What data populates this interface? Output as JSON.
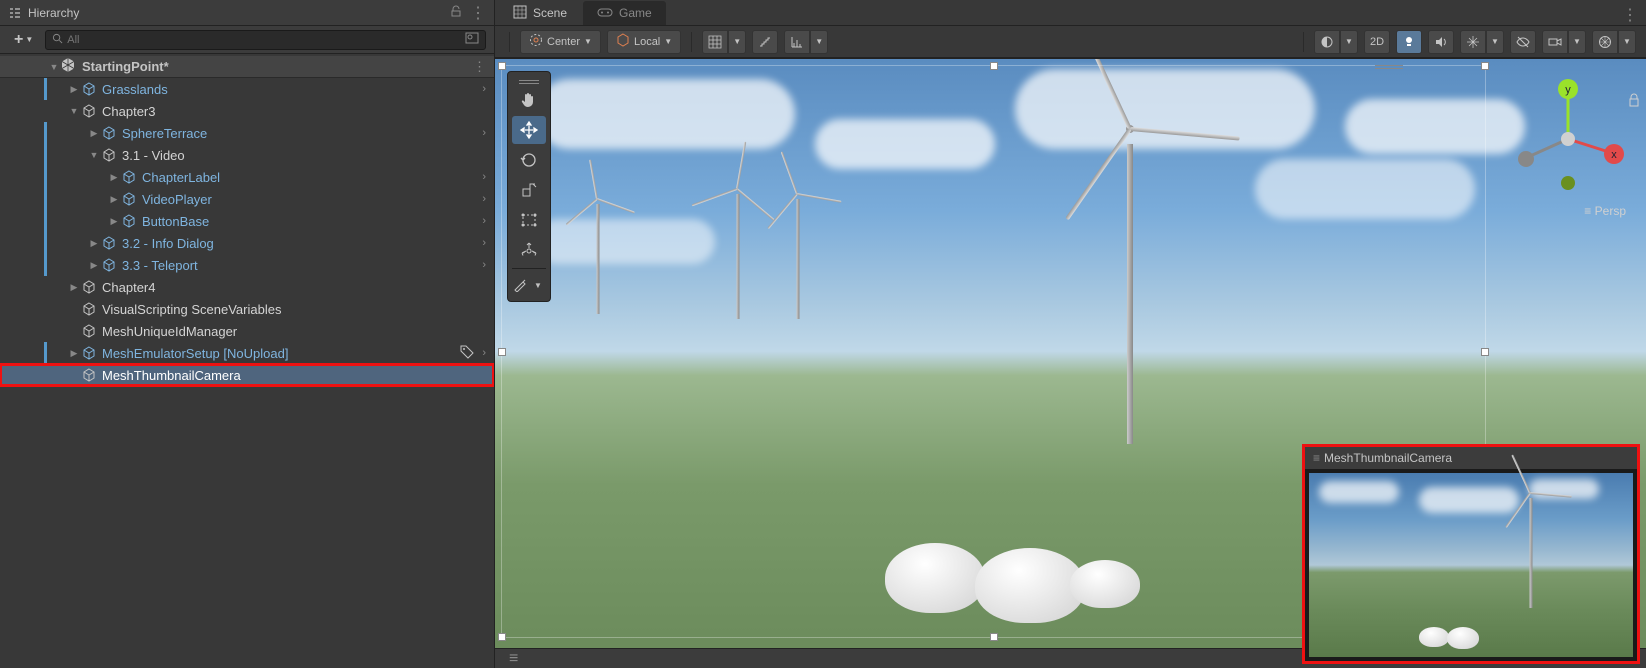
{
  "hierarchy": {
    "panel_title": "Hierarchy",
    "search_placeholder": "All",
    "add_label": "+",
    "scene_root": "StartingPoint*",
    "nodes": [
      {
        "id": "grasslands",
        "label": "Grasslands",
        "depth": 1,
        "color": "blue",
        "expand": "closed",
        "prefab": true
      },
      {
        "id": "chapter3",
        "label": "Chapter3",
        "depth": 1,
        "color": "white",
        "expand": "open",
        "prefab": false
      },
      {
        "id": "sphereterrace",
        "label": "SphereTerrace",
        "depth": 2,
        "color": "blue",
        "expand": "closed",
        "prefab": true
      },
      {
        "id": "video31",
        "label": "3.1 - Video",
        "depth": 2,
        "color": "white",
        "expand": "open",
        "prefab": false
      },
      {
        "id": "chapterlabel",
        "label": "ChapterLabel",
        "depth": 3,
        "color": "blue",
        "expand": "closed",
        "prefab": true
      },
      {
        "id": "videoplayer",
        "label": "VideoPlayer",
        "depth": 3,
        "color": "blue",
        "expand": "closed",
        "prefab": true
      },
      {
        "id": "buttonbase",
        "label": "ButtonBase",
        "depth": 3,
        "color": "blue",
        "expand": "closed",
        "prefab": true
      },
      {
        "id": "infodialog",
        "label": "3.2 - Info Dialog",
        "depth": 2,
        "color": "blue",
        "expand": "closed",
        "prefab": true
      },
      {
        "id": "teleport",
        "label": "3.3 - Teleport",
        "depth": 2,
        "color": "blue",
        "expand": "closed",
        "prefab": true
      },
      {
        "id": "chapter4",
        "label": "Chapter4",
        "depth": 1,
        "color": "white",
        "expand": "closed",
        "prefab": false
      },
      {
        "id": "visualscripting",
        "label": "VisualScripting SceneVariables",
        "depth": 1,
        "color": "white",
        "expand": "none",
        "prefab": false
      },
      {
        "id": "meshuniqueid",
        "label": "MeshUniqueIdManager",
        "depth": 1,
        "color": "white",
        "expand": "none",
        "prefab": false
      },
      {
        "id": "meshemulator",
        "label": "MeshEmulatorSetup [NoUpload]",
        "depth": 1,
        "color": "blue",
        "expand": "closed",
        "prefab": true,
        "tagged": true
      },
      {
        "id": "meshthumbnail",
        "label": "MeshThumbnailCamera",
        "depth": 1,
        "color": "white",
        "expand": "none",
        "prefab": false,
        "selected": true,
        "highlight": true
      }
    ]
  },
  "scene": {
    "tabs": {
      "scene": "Scene",
      "game": "Game"
    },
    "toolbar": {
      "pivot": "Center",
      "handle": "Local",
      "mode_2d": "2D"
    },
    "persp_label": "Persp",
    "camera_preview_label": "MeshThumbnailCamera"
  }
}
